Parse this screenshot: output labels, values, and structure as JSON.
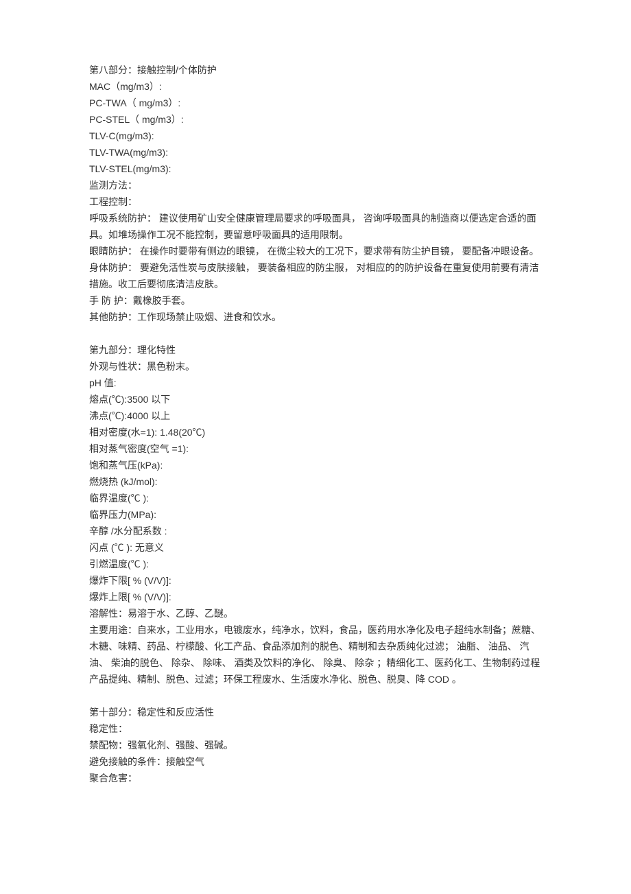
{
  "section8": {
    "heading": "第八部分：接触控制/个体防护",
    "mac": "MAC（mg/m3）:",
    "pctwa": "PC-TWA（ mg/m3）:",
    "pcstel": "PC-STEL（ mg/m3）:",
    "tlvc": "TLV-C(mg/m3):",
    "tlvtwa": "TLV-TWA(mg/m3):",
    "tlvstel": "TLV-STEL(mg/m3):",
    "monitor": "监测方法：",
    "engctrl": "工程控制：",
    "resp": "呼吸系统防护：   建议使用矿山安全健康管理局要求的呼吸面具，   咨询呼吸面具的制造商以便选定合适的面具。如堆场操作工况不能控制，要留意呼吸面具的适用限制。",
    "eye": "眼睛防护：   在操作时要带有侧边的眼镜，   在微尘较大的工况下，要求带有防尘护目镜，   要配备冲眼设备。",
    "body": "身体防护：   要避免活性炭与皮肤接触，   要装备相应的防尘服，   对相应的的防护设备在重复使用前要有清洁措施。收工后要彻底清洁皮肤。",
    "hand": "手  防  护：戴橡胶手套。",
    "other": "其他防护：工作现场禁止吸烟、进食和饮水。"
  },
  "section9": {
    "heading": "第九部分：理化特性",
    "appearance": "外观与性状：黑色粉末。",
    "ph": "pH 值:",
    "melting": "熔点(℃):3500 以下",
    "boiling": "沸点(℃):4000 以上",
    "density": "相对密度(水=1): 1.48(20℃)",
    "vapordensity": "相对蒸气密度(空气  =1):",
    "vaporpressure": "饱和蒸气压(kPa):",
    "combustion": "燃烧热 (kJ/mol):",
    "crittemp": "临界温度(℃  ):",
    "critpressure": "临界压力(MPa):",
    "partition": "辛醇 /水分配系数  :",
    "flash": "闪点 (℃  ): 无意义",
    "ignition": "引燃温度(℃  ):",
    "lel": "爆炸下限[ %  (V/V)]:",
    "uel": "爆炸上限[ %  (V/V)]:",
    "solubility": "溶解性：易溶于水、乙醇、乙醚。",
    "uses": "主要用途：自来水，工业用水，电镀废水，纯净水，饮料，食品，医药用水净化及电子超纯水制备；蔗糖、木糖、味精、药品、柠檬酸、化工产品、食品添加剂的脱色、精制和去杂质纯化过滤；  油脂、  油品、  汽油、  柴油的脱色、  除杂、  除味、  酒类及饮料的净化、  除臭、  除杂  ；精细化工、医药化工、生物制药过程产品提纯、精制、脱色、过滤；环保工程废水、生活废水净化、脱色、脱臭、降 COD 。"
  },
  "section10": {
    "heading": "第十部分：稳定性和反应活性",
    "stability": "稳定性：",
    "incompat": "禁配物：强氧化剂、强酸、强碱。",
    "avoid": "避免接触的条件：接触空气",
    "polyhazard": "聚合危害："
  }
}
